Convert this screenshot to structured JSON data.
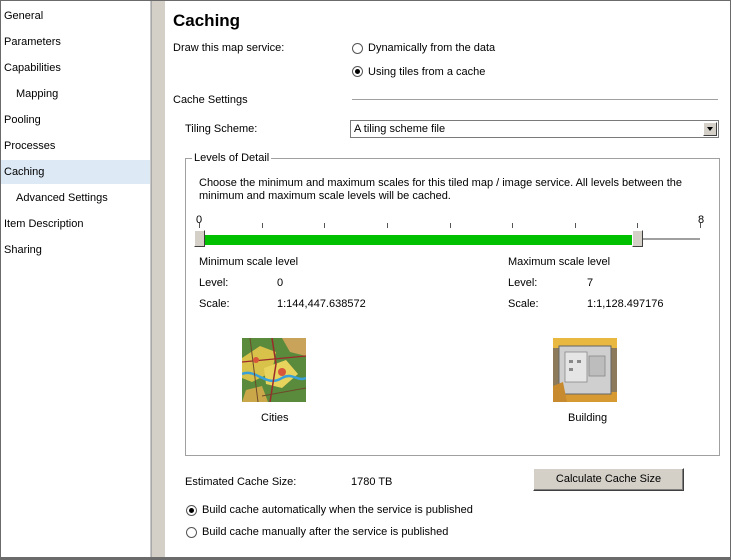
{
  "sidebar": {
    "items": [
      {
        "label": "General"
      },
      {
        "label": "Parameters"
      },
      {
        "label": "Capabilities"
      },
      {
        "label": "Mapping"
      },
      {
        "label": "Pooling"
      },
      {
        "label": "Processes"
      },
      {
        "label": "Caching"
      },
      {
        "label": "Advanced Settings"
      },
      {
        "label": "Item Description"
      },
      {
        "label": "Sharing"
      }
    ],
    "active": "Caching"
  },
  "main": {
    "title": "Caching",
    "draw_label": "Draw this map service:",
    "draw_options": [
      {
        "label": "Dynamically from the data",
        "selected": false
      },
      {
        "label": "Using tiles from a cache",
        "selected": true
      }
    ],
    "cache_settings_label": "Cache Settings",
    "tiling_scheme_label": "Tiling Scheme:",
    "tiling_scheme_value": "A tiling scheme file",
    "levels": {
      "group_label": "Levels of Detail",
      "description": "Choose the minimum and maximum scales for this tiled map / image service. All levels between the minimum and maximum scale levels will be cached.",
      "slider_min_label": "0",
      "slider_max_label": "8",
      "slider_max": 8,
      "range_low": 0,
      "range_high": 7,
      "minimum": {
        "heading": "Minimum scale level",
        "level_label": "Level:",
        "level": "0",
        "scale_label": "Scale:",
        "scale": "1:144,447.638572",
        "preview_caption": "Cities"
      },
      "maximum": {
        "heading": "Maximum scale level",
        "level_label": "Level:",
        "level": "7",
        "scale_label": "Scale:",
        "scale": "1:1,128.497176",
        "preview_caption": "Building"
      }
    },
    "estimated_label": "Estimated Cache Size:",
    "estimated_value": "1780 TB",
    "calculate_button": "Calculate Cache Size",
    "build_options": [
      {
        "label": "Build cache automatically when the service is published",
        "selected": true
      },
      {
        "label": "Build cache manually after the service is published",
        "selected": false
      }
    ]
  },
  "colors": {
    "range_fill": "#00c000",
    "active_nav": "#dde9f5"
  }
}
